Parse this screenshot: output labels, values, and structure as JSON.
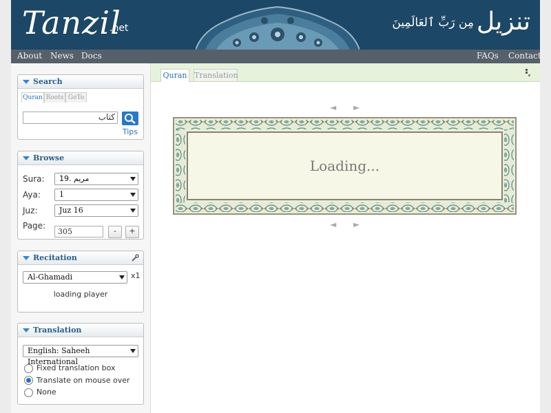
{
  "header": {
    "logo_text": "Tanzil",
    "logo_suffix": ".net",
    "arabic_title": "تنزيل",
    "arabic_subtitle": "مِن رَبِّ ٱلعَالَمِينَ"
  },
  "nav": {
    "left": [
      "About",
      "News",
      "Docs"
    ],
    "right": [
      "FAQs",
      "Contact"
    ]
  },
  "search": {
    "title": "Search",
    "tabs": [
      "Quran",
      "Roots",
      "GoTo"
    ],
    "active_tab": "Quran",
    "query": "كتاب",
    "tips_label": "Tips",
    "icon": "search-icon"
  },
  "browse": {
    "title": "Browse",
    "sura_label": "Sura:",
    "sura_value": "19. مريم",
    "aya_label": "Aya:",
    "aya_value": "1",
    "juz_label": "Juz:",
    "juz_value": "Juz 16",
    "page_label": "Page:",
    "page_value": "305",
    "minus_label": "-",
    "plus_label": "+"
  },
  "recitation": {
    "title": "Recitation",
    "reciter": "Al-Ghamadi",
    "speed": "x1",
    "status": "loading player",
    "icon": "wrench-icon"
  },
  "translation": {
    "title": "Translation",
    "selected": "English: Saheeh International",
    "options": [
      {
        "label": "Fixed translation box",
        "checked": false
      },
      {
        "label": "Translate on mouse over",
        "checked": true
      },
      {
        "label": "None",
        "checked": false
      }
    ]
  },
  "main": {
    "tabs": [
      "Quran",
      "Translation"
    ],
    "active_tab": "Quran",
    "prev_arrow": "◄",
    "next_arrow": "►",
    "loading_text": "Loading..."
  },
  "colors": {
    "header_bg": "#1d4766",
    "nav_bg": "#56606a",
    "accent": "#2b78c6",
    "frame_bg": "#e8efdc"
  }
}
